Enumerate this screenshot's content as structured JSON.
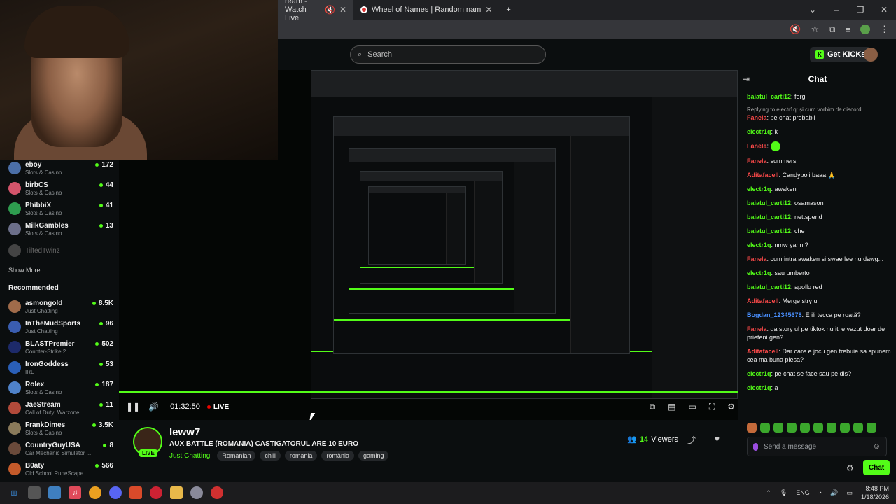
{
  "browser": {
    "tabs": [
      {
        "label": "ream - Watch Live"
      },
      {
        "label": "Wheel of Names | Random nam"
      }
    ]
  },
  "header": {
    "search_placeholder": "Search",
    "get_kicks_label": "Get KICKs"
  },
  "sidebar": {
    "following": [
      {
        "name": "eboy",
        "category": "Slots & Casino",
        "viewers": "172"
      },
      {
        "name": "birbCS",
        "category": "Slots & Casino",
        "viewers": "44"
      },
      {
        "name": "PhibbiX",
        "category": "Slots & Casino",
        "viewers": "41"
      },
      {
        "name": "MilkGambles",
        "category": "Slots & Casino",
        "viewers": "13"
      },
      {
        "name": "TiltedTwinz",
        "category": "",
        "viewers": ""
      }
    ],
    "show_more": "Show More",
    "recommended_title": "Recommended",
    "recommended": [
      {
        "name": "asmongold",
        "category": "Just Chatting",
        "viewers": "8.5K"
      },
      {
        "name": "InTheMudSports",
        "category": "Just Chatting",
        "viewers": "96"
      },
      {
        "name": "BLASTPremier",
        "category": "Counter-Strike 2",
        "viewers": "502"
      },
      {
        "name": "IronGoddess",
        "category": "IRL",
        "viewers": "53"
      },
      {
        "name": "Rolex",
        "category": "Slots & Casino",
        "viewers": "187"
      },
      {
        "name": "JaeStream",
        "category": "Call of Duty: Warzone",
        "viewers": "11"
      },
      {
        "name": "FrankDimes",
        "category": "Slots & Casino",
        "viewers": "3.5K"
      },
      {
        "name": "CountryGuyUSA",
        "category": "Car Mechanic Simulator ...",
        "viewers": "8"
      },
      {
        "name": "B0aty",
        "category": "Old School RuneScape",
        "viewers": "566"
      }
    ]
  },
  "player": {
    "time": "01:32:50",
    "live_label": "LIVE"
  },
  "stream": {
    "streamer": "leww7",
    "live_badge": "LIVE",
    "title": "AUX BATTLE (ROMANIA) CASTIGATORUL ARE 10 EURO",
    "category": "Just Chatting",
    "tags": [
      "Romanian",
      "chill",
      "romania",
      "românia",
      "gaming"
    ],
    "viewers_count": "14",
    "viewers_label": "Viewers"
  },
  "chat": {
    "title": "Chat",
    "messages": [
      {
        "user": "baiatul_carti12",
        "color": "#53fc18",
        "text": "ferg",
        "reply": ""
      },
      {
        "user": "Fanela",
        "color": "#ff4a4a",
        "text": "pe chat probabil",
        "reply": "Replying to electr1q: și cum vorbim de discord ..."
      },
      {
        "user": "electr1q",
        "color": "#53fc18",
        "text": "k",
        "reply": ""
      },
      {
        "user": "Fanela",
        "color": "#ff4a4a",
        "text": "",
        "reply": ""
      },
      {
        "user": "Fanela",
        "color": "#ff4a4a",
        "text": "summers",
        "reply": ""
      },
      {
        "user": "Aditafacell",
        "color": "#ff4a4a",
        "text": "Candyboii baaa 🙏",
        "reply": ""
      },
      {
        "user": "electr1q",
        "color": "#53fc18",
        "text": "awaken",
        "reply": ""
      },
      {
        "user": "baiatul_carti12",
        "color": "#53fc18",
        "text": "osamason",
        "reply": ""
      },
      {
        "user": "baiatul_carti12",
        "color": "#53fc18",
        "text": "nettspend",
        "reply": ""
      },
      {
        "user": "baiatul_carti12",
        "color": "#53fc18",
        "text": "che",
        "reply": ""
      },
      {
        "user": "electr1q",
        "color": "#53fc18",
        "text": "nmw yanni?",
        "reply": ""
      },
      {
        "user": "Fanela",
        "color": "#ff4a4a",
        "text": "cum intra awaken si swae lee nu dawg...",
        "reply": ""
      },
      {
        "user": "electr1q",
        "color": "#53fc18",
        "text": "sau umberto",
        "reply": ""
      },
      {
        "user": "baiatul_carti12",
        "color": "#53fc18",
        "text": "apollo red",
        "reply": ""
      },
      {
        "user": "Aditafacell",
        "color": "#ff4a4a",
        "text": "Merge stry u",
        "reply": ""
      },
      {
        "user": "Bogdan_12345678",
        "color": "#4a90ff",
        "text": "E ili tecca pe roată?",
        "reply": ""
      },
      {
        "user": "Fanela",
        "color": "#ff4a4a",
        "text": "da story ul pe tiktok nu iti e vazut doar de prieteni gen?",
        "reply": ""
      },
      {
        "user": "Aditafacell",
        "color": "#ff4a4a",
        "text": "Dar care e jocu gen trebuie sa spunem cea ma buna piesa?",
        "reply": ""
      },
      {
        "user": "electr1q",
        "color": "#53fc18",
        "text": "pe chat se face sau pe dis?",
        "reply": ""
      },
      {
        "user": "electr1q",
        "color": "#53fc18",
        "text": "a",
        "reply": ""
      }
    ],
    "input_placeholder": "Send a message",
    "send_label": "Chat"
  },
  "taskbar": {
    "lang": "ENG",
    "time": "8:48 PM",
    "date": "1/18/2026"
  },
  "colors": {
    "accent": "#53fc18",
    "background": "#0b0e0f"
  }
}
